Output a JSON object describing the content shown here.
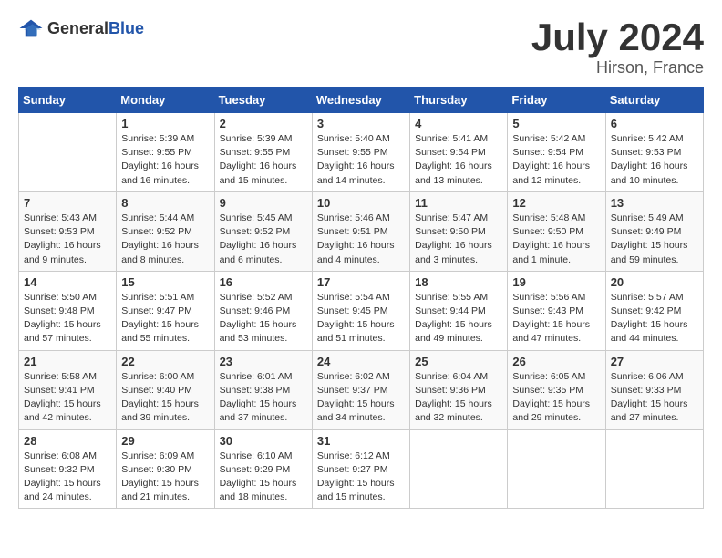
{
  "header": {
    "logo_general": "General",
    "logo_blue": "Blue",
    "title": "July 2024",
    "location": "Hirson, France"
  },
  "calendar": {
    "weekdays": [
      "Sunday",
      "Monday",
      "Tuesday",
      "Wednesday",
      "Thursday",
      "Friday",
      "Saturday"
    ],
    "weeks": [
      [
        {
          "day": "",
          "sunrise": "",
          "sunset": "",
          "daylight": ""
        },
        {
          "day": "1",
          "sunrise": "Sunrise: 5:39 AM",
          "sunset": "Sunset: 9:55 PM",
          "daylight": "Daylight: 16 hours and 16 minutes."
        },
        {
          "day": "2",
          "sunrise": "Sunrise: 5:39 AM",
          "sunset": "Sunset: 9:55 PM",
          "daylight": "Daylight: 16 hours and 15 minutes."
        },
        {
          "day": "3",
          "sunrise": "Sunrise: 5:40 AM",
          "sunset": "Sunset: 9:55 PM",
          "daylight": "Daylight: 16 hours and 14 minutes."
        },
        {
          "day": "4",
          "sunrise": "Sunrise: 5:41 AM",
          "sunset": "Sunset: 9:54 PM",
          "daylight": "Daylight: 16 hours and 13 minutes."
        },
        {
          "day": "5",
          "sunrise": "Sunrise: 5:42 AM",
          "sunset": "Sunset: 9:54 PM",
          "daylight": "Daylight: 16 hours and 12 minutes."
        },
        {
          "day": "6",
          "sunrise": "Sunrise: 5:42 AM",
          "sunset": "Sunset: 9:53 PM",
          "daylight": "Daylight: 16 hours and 10 minutes."
        }
      ],
      [
        {
          "day": "7",
          "sunrise": "Sunrise: 5:43 AM",
          "sunset": "Sunset: 9:53 PM",
          "daylight": "Daylight: 16 hours and 9 minutes."
        },
        {
          "day": "8",
          "sunrise": "Sunrise: 5:44 AM",
          "sunset": "Sunset: 9:52 PM",
          "daylight": "Daylight: 16 hours and 8 minutes."
        },
        {
          "day": "9",
          "sunrise": "Sunrise: 5:45 AM",
          "sunset": "Sunset: 9:52 PM",
          "daylight": "Daylight: 16 hours and 6 minutes."
        },
        {
          "day": "10",
          "sunrise": "Sunrise: 5:46 AM",
          "sunset": "Sunset: 9:51 PM",
          "daylight": "Daylight: 16 hours and 4 minutes."
        },
        {
          "day": "11",
          "sunrise": "Sunrise: 5:47 AM",
          "sunset": "Sunset: 9:50 PM",
          "daylight": "Daylight: 16 hours and 3 minutes."
        },
        {
          "day": "12",
          "sunrise": "Sunrise: 5:48 AM",
          "sunset": "Sunset: 9:50 PM",
          "daylight": "Daylight: 16 hours and 1 minute."
        },
        {
          "day": "13",
          "sunrise": "Sunrise: 5:49 AM",
          "sunset": "Sunset: 9:49 PM",
          "daylight": "Daylight: 15 hours and 59 minutes."
        }
      ],
      [
        {
          "day": "14",
          "sunrise": "Sunrise: 5:50 AM",
          "sunset": "Sunset: 9:48 PM",
          "daylight": "Daylight: 15 hours and 57 minutes."
        },
        {
          "day": "15",
          "sunrise": "Sunrise: 5:51 AM",
          "sunset": "Sunset: 9:47 PM",
          "daylight": "Daylight: 15 hours and 55 minutes."
        },
        {
          "day": "16",
          "sunrise": "Sunrise: 5:52 AM",
          "sunset": "Sunset: 9:46 PM",
          "daylight": "Daylight: 15 hours and 53 minutes."
        },
        {
          "day": "17",
          "sunrise": "Sunrise: 5:54 AM",
          "sunset": "Sunset: 9:45 PM",
          "daylight": "Daylight: 15 hours and 51 minutes."
        },
        {
          "day": "18",
          "sunrise": "Sunrise: 5:55 AM",
          "sunset": "Sunset: 9:44 PM",
          "daylight": "Daylight: 15 hours and 49 minutes."
        },
        {
          "day": "19",
          "sunrise": "Sunrise: 5:56 AM",
          "sunset": "Sunset: 9:43 PM",
          "daylight": "Daylight: 15 hours and 47 minutes."
        },
        {
          "day": "20",
          "sunrise": "Sunrise: 5:57 AM",
          "sunset": "Sunset: 9:42 PM",
          "daylight": "Daylight: 15 hours and 44 minutes."
        }
      ],
      [
        {
          "day": "21",
          "sunrise": "Sunrise: 5:58 AM",
          "sunset": "Sunset: 9:41 PM",
          "daylight": "Daylight: 15 hours and 42 minutes."
        },
        {
          "day": "22",
          "sunrise": "Sunrise: 6:00 AM",
          "sunset": "Sunset: 9:40 PM",
          "daylight": "Daylight: 15 hours and 39 minutes."
        },
        {
          "day": "23",
          "sunrise": "Sunrise: 6:01 AM",
          "sunset": "Sunset: 9:38 PM",
          "daylight": "Daylight: 15 hours and 37 minutes."
        },
        {
          "day": "24",
          "sunrise": "Sunrise: 6:02 AM",
          "sunset": "Sunset: 9:37 PM",
          "daylight": "Daylight: 15 hours and 34 minutes."
        },
        {
          "day": "25",
          "sunrise": "Sunrise: 6:04 AM",
          "sunset": "Sunset: 9:36 PM",
          "daylight": "Daylight: 15 hours and 32 minutes."
        },
        {
          "day": "26",
          "sunrise": "Sunrise: 6:05 AM",
          "sunset": "Sunset: 9:35 PM",
          "daylight": "Daylight: 15 hours and 29 minutes."
        },
        {
          "day": "27",
          "sunrise": "Sunrise: 6:06 AM",
          "sunset": "Sunset: 9:33 PM",
          "daylight": "Daylight: 15 hours and 27 minutes."
        }
      ],
      [
        {
          "day": "28",
          "sunrise": "Sunrise: 6:08 AM",
          "sunset": "Sunset: 9:32 PM",
          "daylight": "Daylight: 15 hours and 24 minutes."
        },
        {
          "day": "29",
          "sunrise": "Sunrise: 6:09 AM",
          "sunset": "Sunset: 9:30 PM",
          "daylight": "Daylight: 15 hours and 21 minutes."
        },
        {
          "day": "30",
          "sunrise": "Sunrise: 6:10 AM",
          "sunset": "Sunset: 9:29 PM",
          "daylight": "Daylight: 15 hours and 18 minutes."
        },
        {
          "day": "31",
          "sunrise": "Sunrise: 6:12 AM",
          "sunset": "Sunset: 9:27 PM",
          "daylight": "Daylight: 15 hours and 15 minutes."
        },
        {
          "day": "",
          "sunrise": "",
          "sunset": "",
          "daylight": ""
        },
        {
          "day": "",
          "sunrise": "",
          "sunset": "",
          "daylight": ""
        },
        {
          "day": "",
          "sunrise": "",
          "sunset": "",
          "daylight": ""
        }
      ]
    ]
  }
}
